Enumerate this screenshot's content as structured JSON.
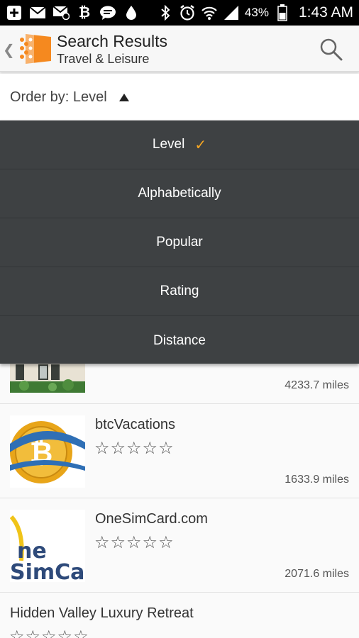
{
  "status": {
    "battery_pct": "43%",
    "time": "1:43 AM",
    "icons": [
      "plus-box-icon",
      "mail-icon",
      "mail-at-icon",
      "bitcoin-icon",
      "chat-bubble-icon",
      "drop-icon",
      "bluetooth-icon",
      "alarm-icon",
      "wifi-icon",
      "signal-icon",
      "battery-icon"
    ]
  },
  "header": {
    "title": "Search Results",
    "subtitle": "Travel & Leisure",
    "back_glyph": "❮",
    "accent": "#f5891f"
  },
  "order": {
    "label": "Order by: Level"
  },
  "dropdown": {
    "items": [
      {
        "label": "Level",
        "selected": true
      },
      {
        "label": "Alphabetically",
        "selected": false
      },
      {
        "label": "Popular",
        "selected": false
      },
      {
        "label": "Rating",
        "selected": false
      },
      {
        "label": "Distance",
        "selected": false
      }
    ],
    "check_glyph": "✓",
    "bg": "#3e4143",
    "check_color": "#f5a623"
  },
  "results": [
    {
      "name": "",
      "stars": "",
      "distance": "4233.7 miles"
    },
    {
      "name": "btcVacations",
      "stars": "☆☆☆☆☆",
      "distance": "1633.9 miles"
    },
    {
      "name": "OneSimCard.com",
      "stars": "☆☆☆☆☆",
      "distance": "2071.6 miles"
    },
    {
      "name": "Hidden Valley Luxury Retreat",
      "stars": "☆☆☆☆☆",
      "distance": ""
    }
  ],
  "logos": {
    "bitcoin": "₿",
    "onesim_top": "ne",
    "onesim_bottom": "SimCa"
  }
}
